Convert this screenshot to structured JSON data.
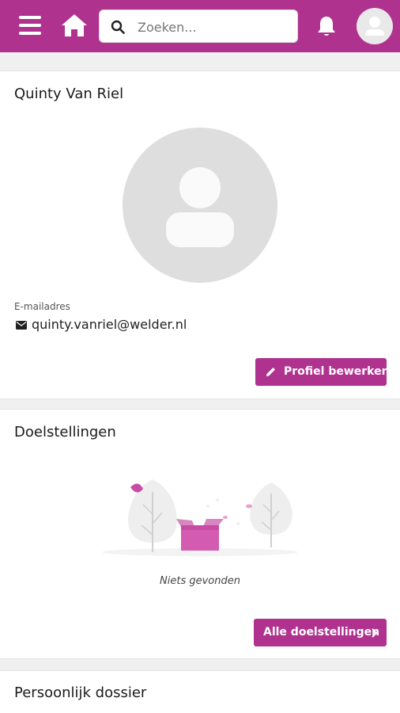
{
  "header": {
    "search_placeholder": "Zoeken...",
    "icons": [
      "menu-icon",
      "home-icon",
      "search-icon",
      "bell-icon",
      "user-avatar-icon"
    ],
    "colors": {
      "brand": "#b0328f",
      "background": "#f0f0f0"
    }
  },
  "profile": {
    "name": "Quinty Van Riel",
    "email_label": "E-mailadres",
    "email": "quinty.vanriel@welder.nl",
    "edit_button": "Profiel bewerken"
  },
  "goals": {
    "title": "Doelstellingen",
    "empty_text": "Niets gevonden",
    "all_button": "Alle doelstellingen"
  },
  "dossier": {
    "title": "Persoonlijk dossier"
  }
}
